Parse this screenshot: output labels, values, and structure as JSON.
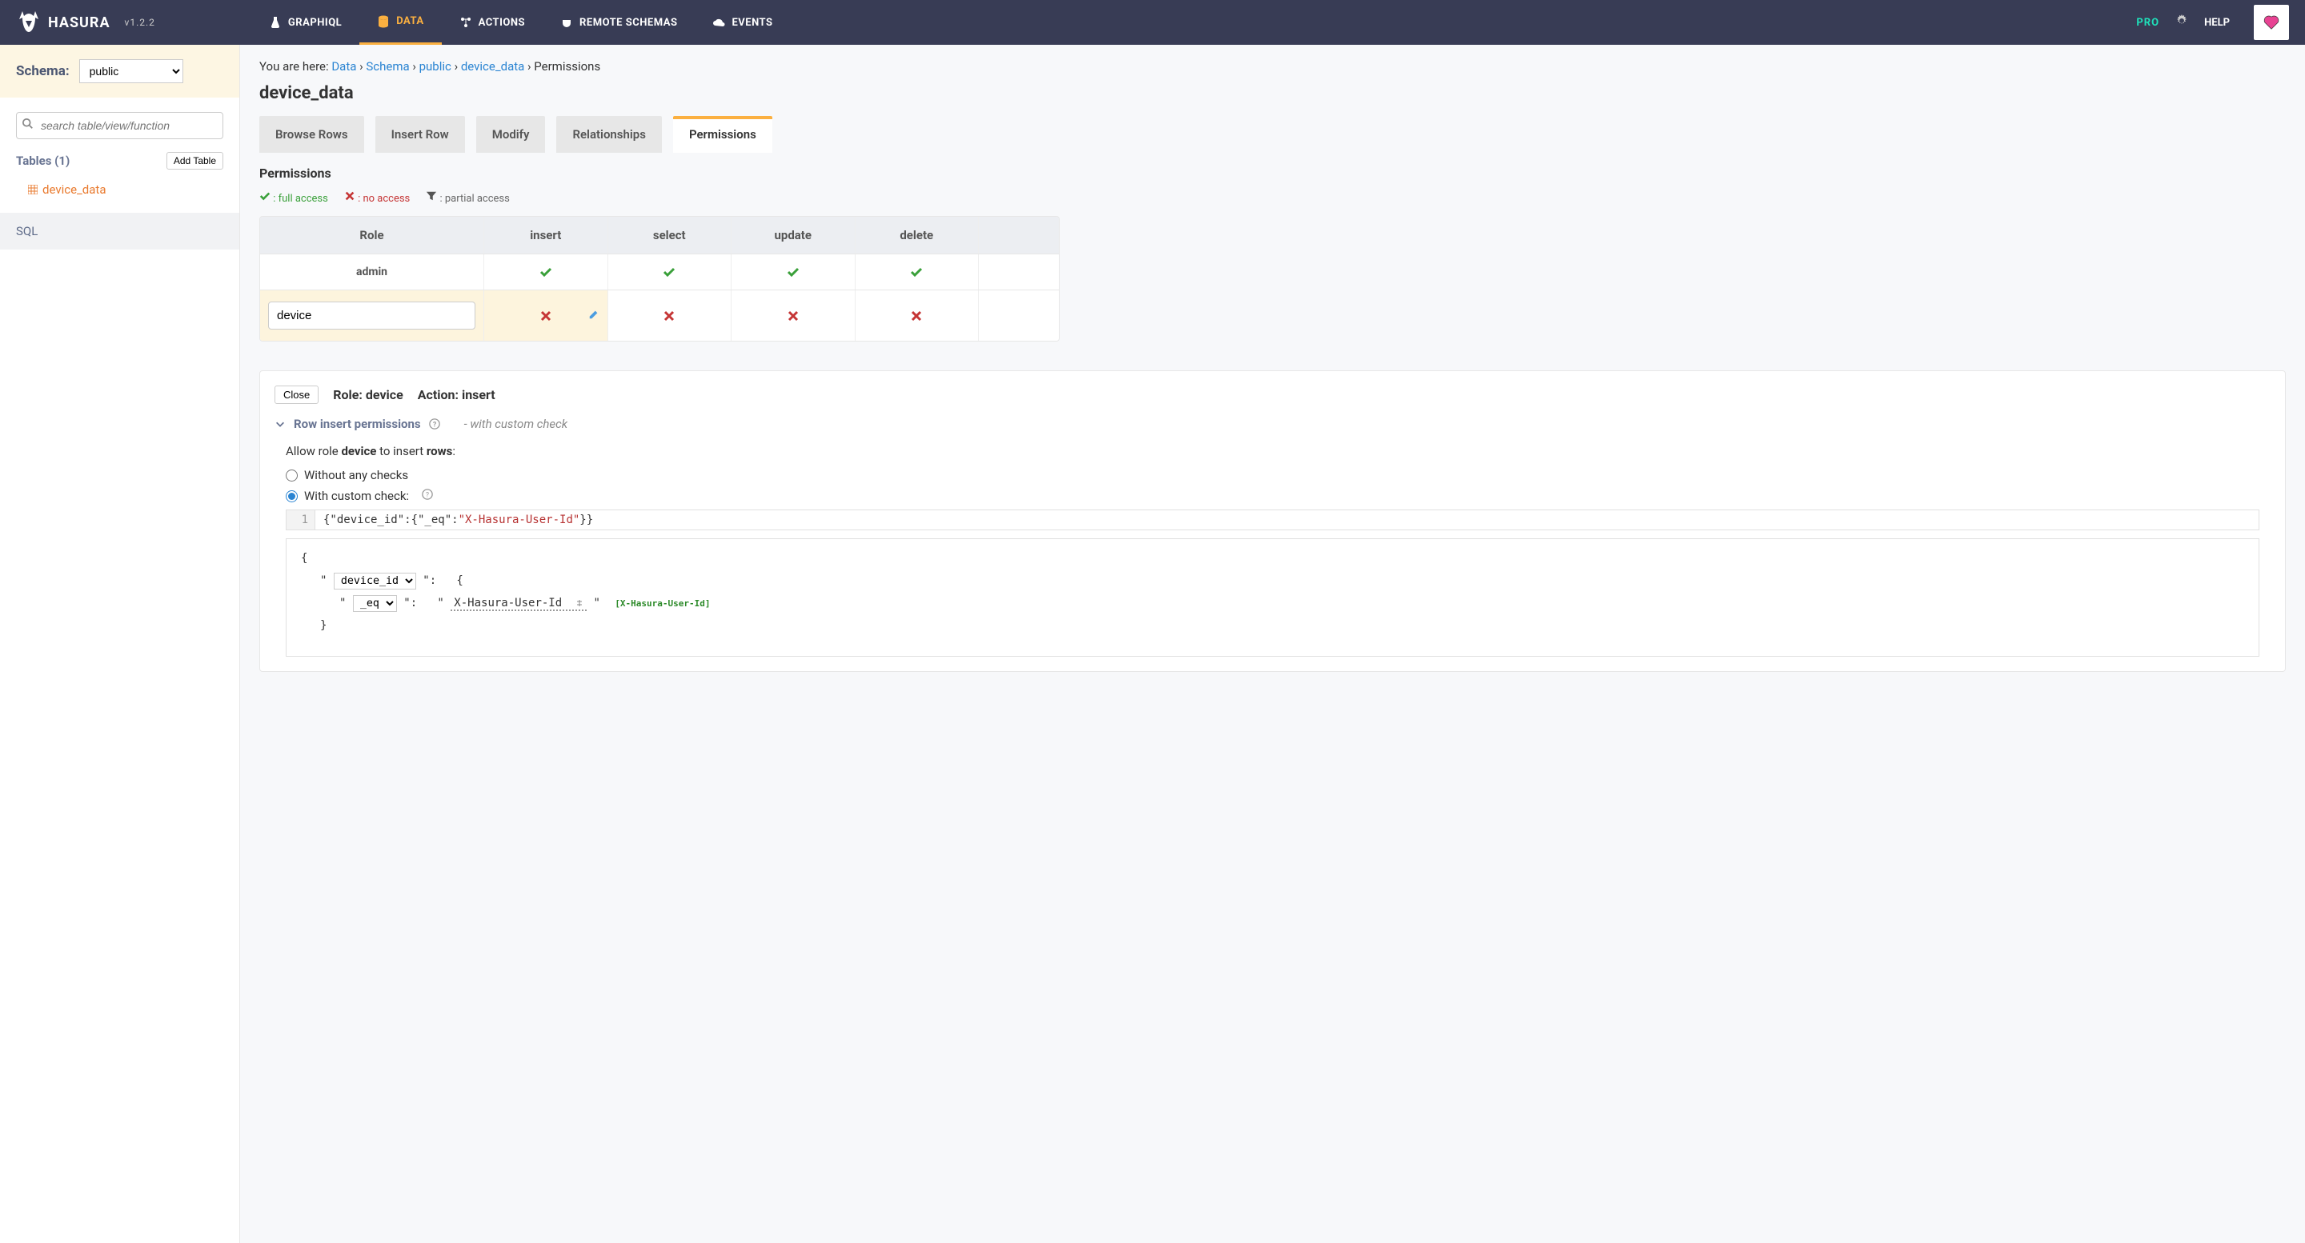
{
  "header": {
    "brand": "HASURA",
    "version": "v1.2.2",
    "nav": {
      "graphiql": "GRAPHIQL",
      "data": "DATA",
      "actions": "ACTIONS",
      "remote": "REMOTE SCHEMAS",
      "events": "EVENTS"
    },
    "pro": "PRO",
    "help": "HELP"
  },
  "sidebar": {
    "schema_label": "Schema:",
    "schema_value": "public",
    "search_placeholder": "search table/view/function",
    "tables_label": "Tables (1)",
    "add_table": "Add Table",
    "table1": "device_data",
    "sql": "SQL"
  },
  "breadcrumb": {
    "prefix": "You are here: ",
    "data": "Data",
    "schema": "Schema",
    "public": "public",
    "table": "device_data",
    "leaf": "Permissions"
  },
  "page_title": "device_data",
  "tabs": {
    "browse": "Browse Rows",
    "insert": "Insert Row",
    "modify": "Modify",
    "rel": "Relationships",
    "perm": "Permissions"
  },
  "section_title": "Permissions",
  "legend": {
    "full": ": full access",
    "no": ": no access",
    "partial": ": partial access"
  },
  "perm_table": {
    "headers": {
      "role": "Role",
      "insert": "insert",
      "select": "select",
      "update": "update",
      "delete": "delete"
    },
    "admin_label": "admin",
    "new_role": "device"
  },
  "panel": {
    "close": "Close",
    "role_label": "Role: device",
    "action_label": "Action: insert",
    "section": "Row insert permissions",
    "note": "- with custom check",
    "allow_prefix": "Allow role ",
    "allow_role": "device",
    "allow_mid": " to insert ",
    "allow_rows": "rows",
    "radio1": "Without any checks",
    "radio2": "With custom check:",
    "code_json": "{\"device_id\":{\"_eq\":",
    "code_val": "\"X-Hasura-User-Id\"",
    "code_end": "}}",
    "builder": {
      "field": "device_id",
      "op": "_eq",
      "val": "X-Hasura-User-Id",
      "hint": "[X-Hasura-User-Id]"
    }
  }
}
